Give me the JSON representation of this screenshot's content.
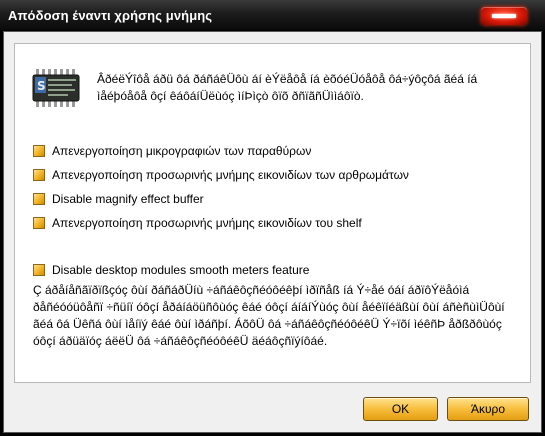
{
  "window": {
    "title": "Απόδοση έναντι χρήσης μνήμης"
  },
  "panel": {
    "description": "ÂðéëÝîôå áðü ôá ðáñáêÜôù áí èÝëåôå íá èõóéÜóåôå ôá÷ýôçôá ãéá íá ìåéþóåôå ôçí êáôáíÜëùóç ìíÞìçò ôïõ ðñïãñÜììáôïò.",
    "options": [
      {
        "label": "Απενεργοποίηση μικρογραφιών των παραθύρων",
        "checked": false
      },
      {
        "label": "Απενεργοποίηση προσωρινής μνήμης εικονιδίων των αρθρωμάτων",
        "checked": false
      },
      {
        "label": "Disable magnify effect buffer",
        "checked": false
      },
      {
        "label": "Απενεργοποίηση προσωρινής μνήμης εικονιδίων του shelf",
        "checked": false
      },
      {
        "label": "Disable desktop modules smooth meters feature",
        "checked": false
      }
    ],
    "footnote": "Ç áðåíåñãïðïßçóç ôùí ðáñáðÜíù ÷áñáêôçñéóôéêþí ìðïñåß íá Ý÷åé óáí áðïôÝëåóìá ðåñéóóüôåñï ÷ñüíï óôçí åðáíáöüñôùóç êáé óôçí áíáíÝùóç ôùí åéêïíéäßùí ôùí áñèñùìÜôùí ãéá ôá Üêñá ôùí ìåíïý êáé ôùí ìðáñþí. ÁõôÜ ôá ÷áñáêôçñéóôéêÜ Ý÷ïõí ìéêñÞ åðßðôùóç óôçí áðüäïóç áëëÜ ôá ÷áñáêôçñéóôéêÜ äéáôçñïýíôáé."
  },
  "buttons": {
    "ok": "OK",
    "cancel": "Άκυρο"
  }
}
